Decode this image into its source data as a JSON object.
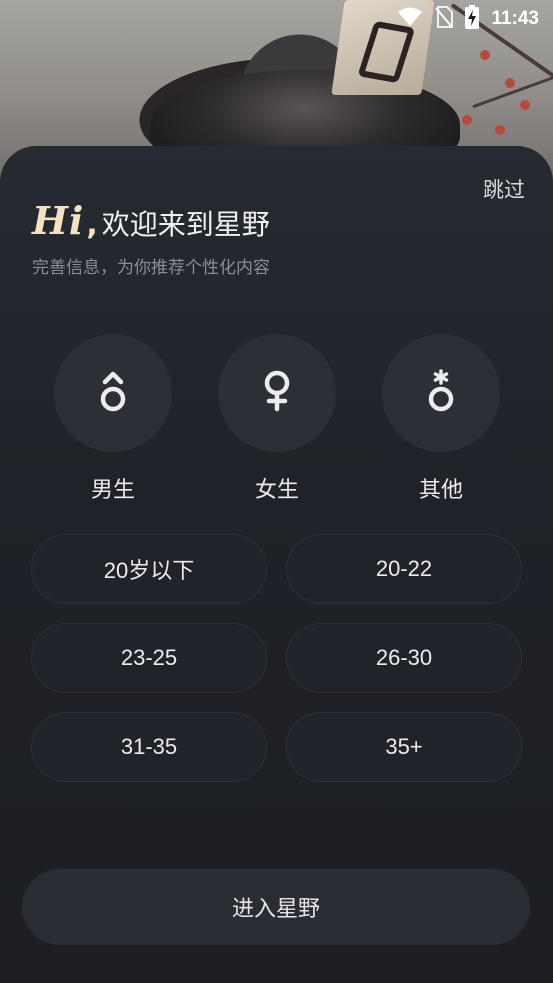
{
  "status_bar": {
    "time": "11:43",
    "icons": [
      "wifi-icon",
      "no-sim-icon",
      "battery-charging-icon"
    ]
  },
  "header": {
    "skip_label": "跳过",
    "hi": "Hi",
    "comma": ",",
    "title": "欢迎来到星野",
    "subtitle": "完善信息，为你推荐个性化内容"
  },
  "genders": [
    {
      "label": "男生",
      "icon": "male-icon"
    },
    {
      "label": "女生",
      "icon": "female-icon"
    },
    {
      "label": "其他",
      "icon": "other-gender-icon"
    }
  ],
  "ages": [
    "20岁以下",
    "20-22",
    "23-25",
    "26-30",
    "31-35",
    "35+"
  ],
  "enter_label": "进入星野",
  "colors": {
    "sheet": "#1f2228",
    "accent_hi": "#f3e4c0",
    "circle": "#2c2f36",
    "button": "#2a2d33"
  }
}
